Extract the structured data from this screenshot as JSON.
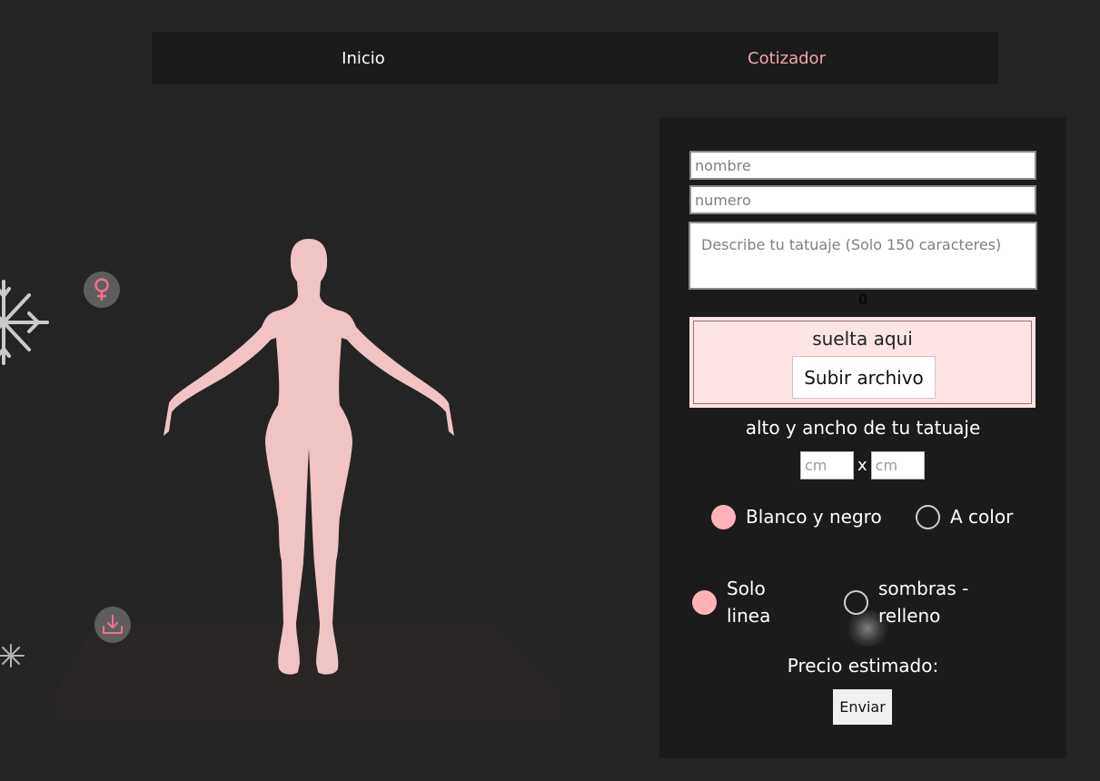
{
  "nav": {
    "home_label": "Inicio",
    "quote_label": "Cotizador"
  },
  "viewer": {
    "gender_icon": "female-symbol-icon",
    "download_icon": "download-icon",
    "accent_color": "#f0738c",
    "figure_color": "#f0c3c4"
  },
  "form": {
    "name_placeholder": "nombre",
    "phone_placeholder": "numero",
    "description_placeholder": "Describe tu tatuaje (Solo 150 caracteres)",
    "char_count": "0",
    "drop_label": "suelta aqui",
    "upload_label": "Subir archivo",
    "size_title": "alto y ancho de tu tatuaje",
    "height_placeholder": "cm",
    "width_placeholder": "cm",
    "size_separator": "x",
    "color_options": [
      {
        "label": "Blanco y negro",
        "selected": true
      },
      {
        "label": "A color",
        "selected": false
      }
    ],
    "style_options": [
      {
        "label": "Solo linea",
        "selected": true
      },
      {
        "label": "sombras - relleno",
        "selected": false
      }
    ],
    "price_label": "Precio estimado:",
    "submit_label": "Enviar",
    "selected_color": "#ffb3b8"
  }
}
